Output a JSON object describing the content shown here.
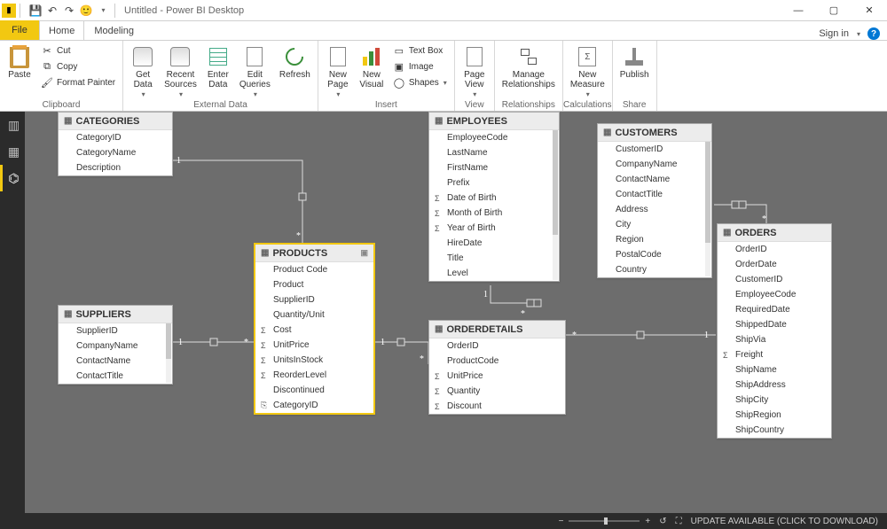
{
  "window": {
    "title": "Untitled - Power BI Desktop",
    "sign_in": "Sign in"
  },
  "qat": {
    "save": "💾",
    "undo": "↶",
    "redo": "↷",
    "smile": "🙂"
  },
  "tabs": {
    "file": "File",
    "home": "Home",
    "modeling": "Modeling"
  },
  "ribbon": {
    "clipboard": {
      "label": "Clipboard",
      "paste": "Paste",
      "cut": "Cut",
      "copy": "Copy",
      "format_painter": "Format Painter"
    },
    "external_data": {
      "label": "External Data",
      "get_data": "Get\nData",
      "recent_sources": "Recent\nSources",
      "enter_data": "Enter\nData",
      "edit_queries": "Edit\nQueries",
      "refresh": "Refresh"
    },
    "insert": {
      "label": "Insert",
      "new_page": "New\nPage",
      "new_visual": "New\nVisual",
      "text_box": "Text Box",
      "image": "Image",
      "shapes": "Shapes"
    },
    "view": {
      "label": "View",
      "page_view": "Page\nView"
    },
    "relationships": {
      "label": "Relationships",
      "manage": "Manage\nRelationships"
    },
    "calculations": {
      "label": "Calculations",
      "new_measure": "New\nMeasure"
    },
    "share": {
      "label": "Share",
      "publish": "Publish"
    }
  },
  "tables": {
    "categories": {
      "name": "CATEGORIES",
      "fields": [
        "CategoryID",
        "CategoryName",
        "Description"
      ]
    },
    "suppliers": {
      "name": "SUPPLIERS",
      "fields": [
        "SupplierID",
        "CompanyName",
        "ContactName",
        "ContactTitle"
      ]
    },
    "products": {
      "name": "PRODUCTS",
      "fields": [
        {
          "n": "Product Code"
        },
        {
          "n": "Product"
        },
        {
          "n": "SupplierID"
        },
        {
          "n": "Quantity/Unit"
        },
        {
          "n": "Cost",
          "sigma": true
        },
        {
          "n": "UnitPrice",
          "sigma": true
        },
        {
          "n": "UnitsInStock",
          "sigma": true
        },
        {
          "n": "ReorderLevel",
          "sigma": true
        },
        {
          "n": "Discontinued"
        },
        {
          "n": "CategoryID",
          "link": true
        }
      ]
    },
    "employees": {
      "name": "EMPLOYEES",
      "fields": [
        {
          "n": "EmployeeCode"
        },
        {
          "n": "LastName"
        },
        {
          "n": "FirstName"
        },
        {
          "n": "Prefix"
        },
        {
          "n": "Date of Birth",
          "sigma": true
        },
        {
          "n": "Month of Birth",
          "sigma": true
        },
        {
          "n": "Year of Birth",
          "sigma": true
        },
        {
          "n": "HireDate"
        },
        {
          "n": "Title"
        },
        {
          "n": "Level"
        }
      ]
    },
    "customers": {
      "name": "CUSTOMERS",
      "fields": [
        "CustomerID",
        "CompanyName",
        "ContactName",
        "ContactTitle",
        "Address",
        "City",
        "Region",
        "PostalCode",
        "Country"
      ]
    },
    "orderdetails": {
      "name": "ORDERDETAILS",
      "fields": [
        {
          "n": "OrderID"
        },
        {
          "n": "ProductCode"
        },
        {
          "n": "UnitPrice",
          "sigma": true
        },
        {
          "n": "Quantity",
          "sigma": true
        },
        {
          "n": "Discount",
          "sigma": true
        }
      ]
    },
    "orders": {
      "name": "ORDERS",
      "fields": [
        {
          "n": "OrderID"
        },
        {
          "n": "OrderDate"
        },
        {
          "n": "CustomerID"
        },
        {
          "n": "EmployeeCode"
        },
        {
          "n": "RequiredDate"
        },
        {
          "n": "ShippedDate"
        },
        {
          "n": "ShipVia"
        },
        {
          "n": "Freight",
          "sigma": true
        },
        {
          "n": "ShipName"
        },
        {
          "n": "ShipAddress"
        },
        {
          "n": "ShipCity"
        },
        {
          "n": "ShipRegion"
        },
        {
          "n": "ShipCountry"
        }
      ]
    }
  },
  "status": {
    "update": "UPDATE AVAILABLE (CLICK TO DOWNLOAD)"
  }
}
